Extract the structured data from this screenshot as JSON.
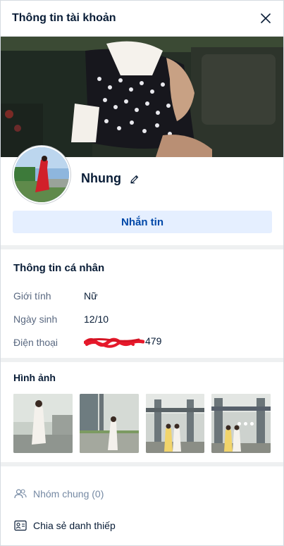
{
  "header": {
    "title": "Thông tin tài khoản"
  },
  "profile": {
    "name": "Nhung"
  },
  "actions": {
    "message_label": "Nhắn tin"
  },
  "personal_info": {
    "title": "Thông tin cá nhân",
    "rows": [
      {
        "label": "Giới tính",
        "value": "Nữ"
      },
      {
        "label": "Ngày sinh",
        "value": "12/10"
      },
      {
        "label": "Điện thoại",
        "value": "479"
      }
    ]
  },
  "photos": {
    "title": "Hình ảnh",
    "count_visible": 4
  },
  "menu": {
    "items": [
      {
        "label": "Nhóm chung (0)",
        "icon": "group-icon",
        "disabled": true
      },
      {
        "label": "Chia sẻ danh thiếp",
        "icon": "contact-card-icon",
        "disabled": false
      }
    ]
  },
  "colors": {
    "accent": "#0048a8",
    "button_bg": "#e5efff",
    "divider": "#eef0f1",
    "scribble": "#e6192b"
  }
}
